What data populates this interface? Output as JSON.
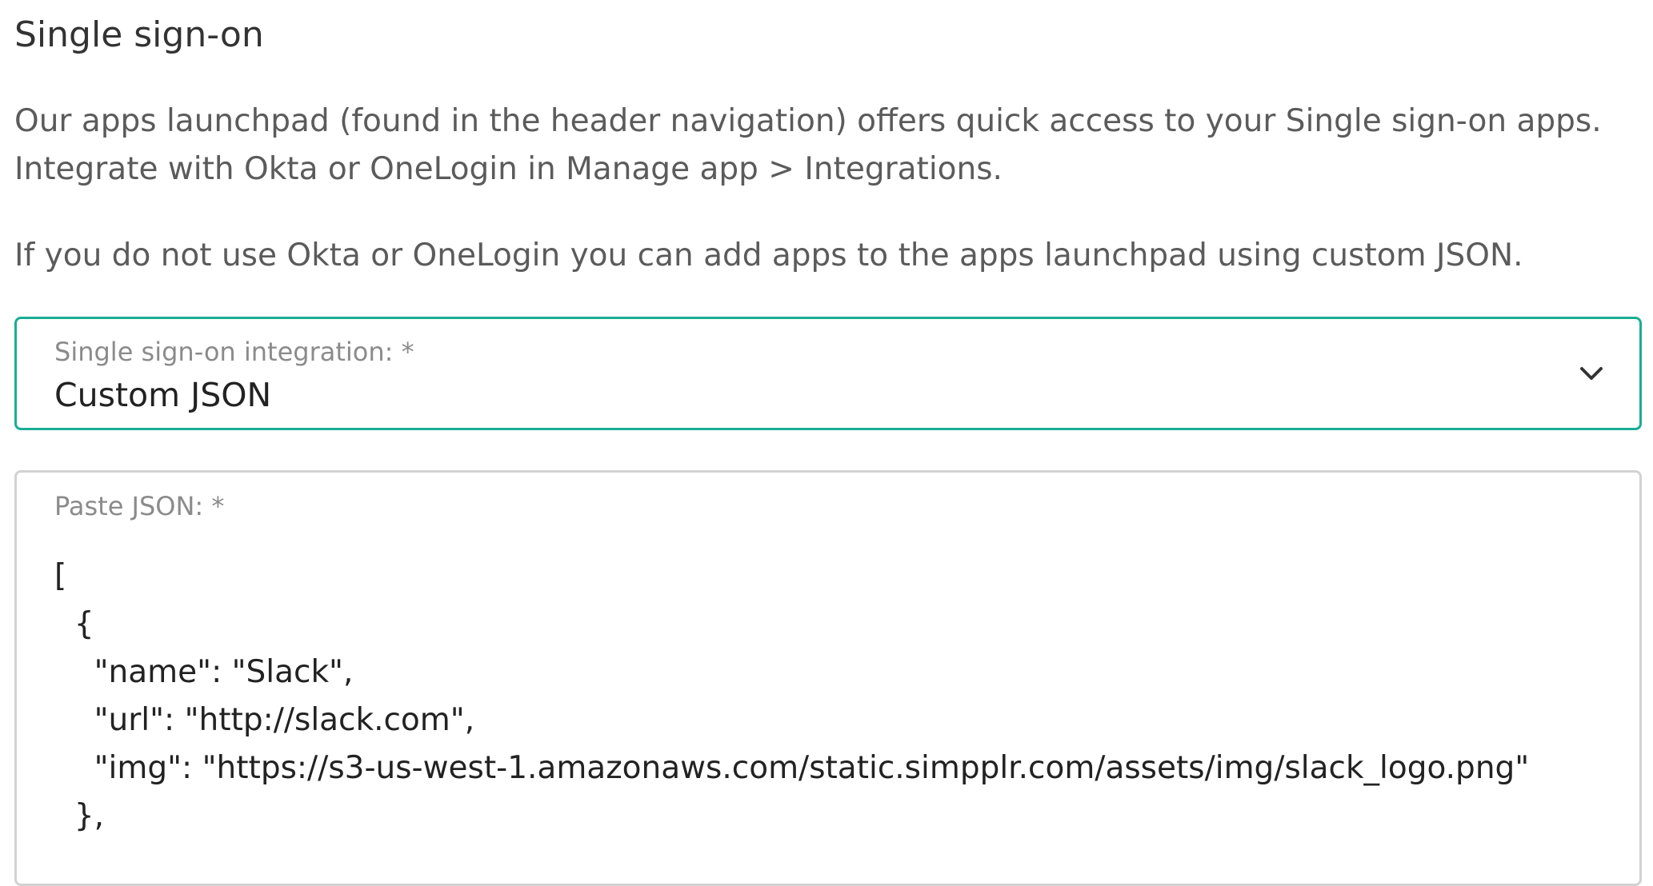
{
  "section": {
    "title": "Single sign-on",
    "description_line1": "Our apps launchpad (found in the header navigation) offers quick access to your Single sign-on apps.",
    "description_line2": "Integrate with Okta or OneLogin in Manage app > Integrations.",
    "description_line3": "If you do not use Okta or OneLogin you can add apps to the apps launchpad using custom JSON."
  },
  "integration_select": {
    "label": "Single sign-on integration: *",
    "selected_value": "Custom JSON",
    "icon": "chevron-down-icon",
    "border_color": "#1aad94"
  },
  "json_field": {
    "label": "Paste JSON: *",
    "value_lines": [
      "[",
      "  {",
      "    \"name\": \"Slack\",",
      "    \"url\": \"http://slack.com\",",
      "    \"img\": \"https://s3-us-west-1.amazonaws.com/static.simpplr.com/assets/img/slack_logo.png\"",
      "  },"
    ]
  }
}
